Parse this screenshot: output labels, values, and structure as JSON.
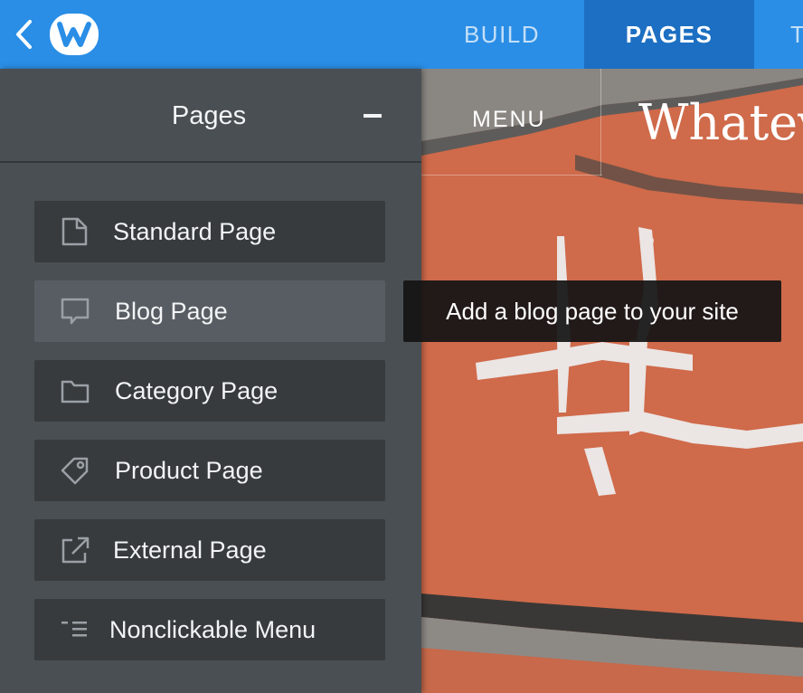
{
  "topbar": {
    "back_icon": "chevron-left-icon",
    "logo_icon": "weebly-w-logo-icon",
    "tabs": [
      {
        "label": "BUILD",
        "active": false
      },
      {
        "label": "PAGES",
        "active": true
      },
      {
        "label": "T",
        "active": false
      }
    ]
  },
  "sidebar": {
    "title": "Pages",
    "collapse_icon": "minus-icon",
    "items": [
      {
        "label": "Standard Page",
        "icon": "page-icon",
        "active": false
      },
      {
        "label": "Blog Page",
        "icon": "speech-bubble-icon",
        "active": true
      },
      {
        "label": "Category Page",
        "icon": "folder-icon",
        "active": false
      },
      {
        "label": "Product Page",
        "icon": "tag-icon",
        "active": false
      },
      {
        "label": "External Page",
        "icon": "external-link-icon",
        "active": false
      },
      {
        "label": "Nonclickable Menu",
        "icon": "indented-list-icon",
        "active": false
      }
    ]
  },
  "tooltip": {
    "text": "Add a blog page to your site"
  },
  "preview": {
    "menu_label": "MENU",
    "site_title": "Whatev"
  },
  "colors": {
    "topbar": "#2a8ee6",
    "active_tab": "#1c6fc2",
    "sidebar": "#4a4f54",
    "item": "#373b3e",
    "item_active": "#575d62",
    "brick": "#cf6a4a"
  }
}
